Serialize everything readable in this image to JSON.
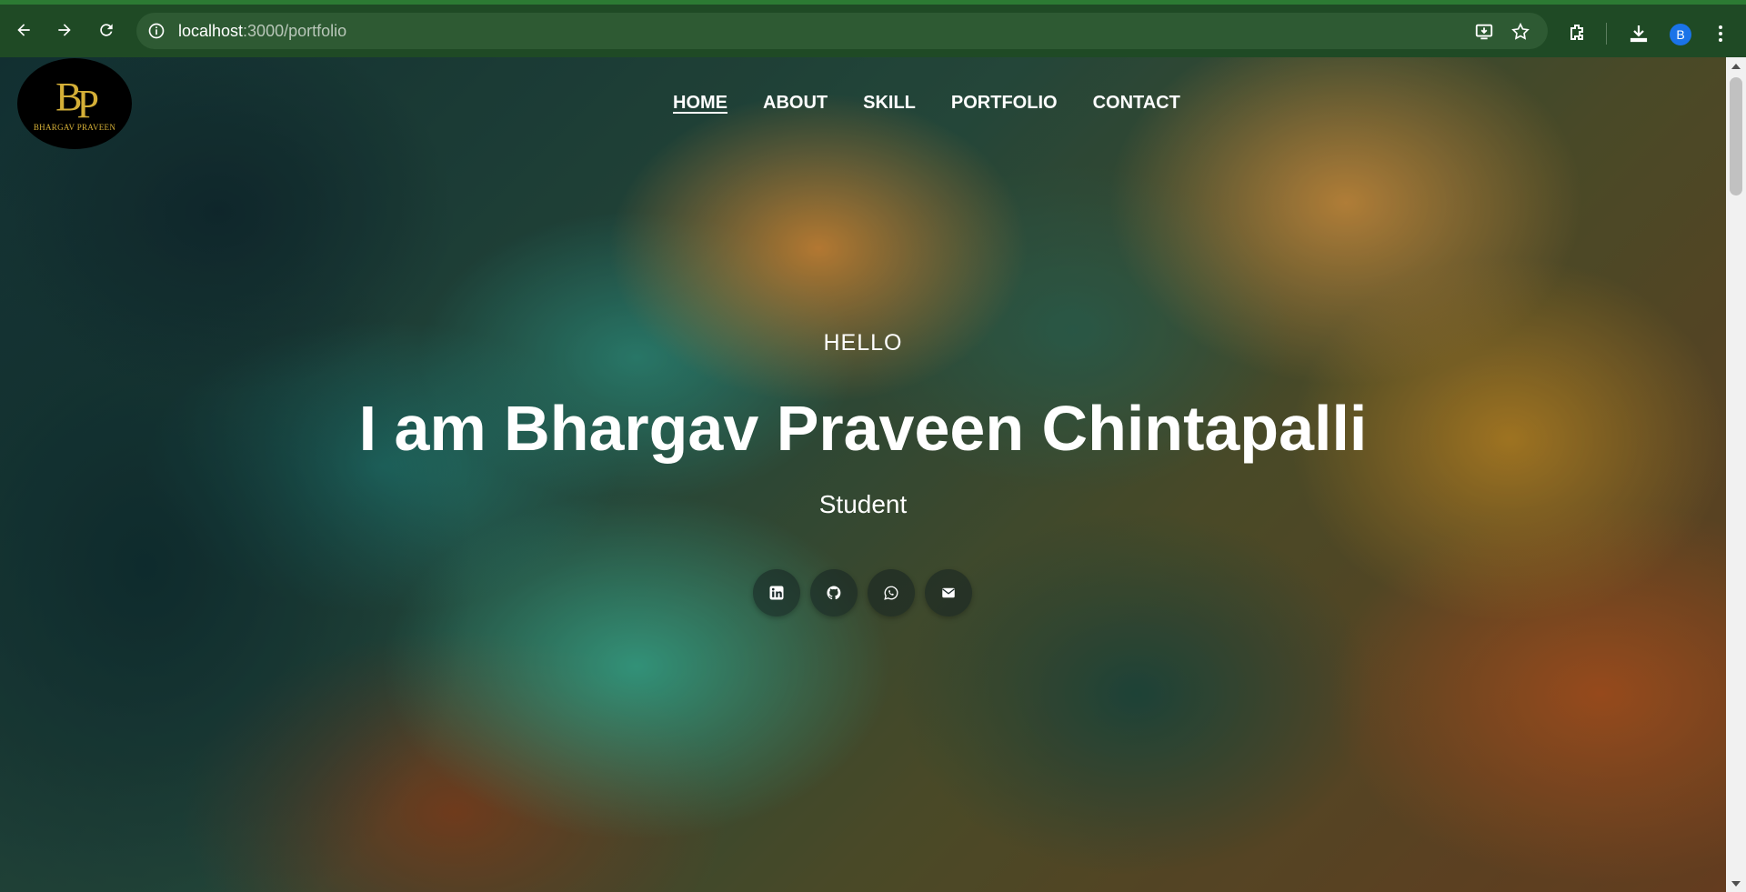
{
  "browser": {
    "url_host": "localhost",
    "url_path": ":3000/portfolio",
    "profile_initial": "B",
    "accent_color": "#1f4a25"
  },
  "site": {
    "logo": {
      "monogram_first": "B",
      "monogram_second": "P",
      "name": "Bhargav Praveen"
    },
    "nav": [
      {
        "label": "HOME",
        "active": true
      },
      {
        "label": "ABOUT",
        "active": false
      },
      {
        "label": "SKILL",
        "active": false
      },
      {
        "label": "PORTFOLIO",
        "active": false
      },
      {
        "label": "CONTACT",
        "active": false
      }
    ],
    "hero": {
      "greeting": "HELLO",
      "headline": "I am Bhargav Praveen Chintapalli",
      "role": "Student"
    },
    "socials": [
      {
        "icon": "linkedin-icon"
      },
      {
        "icon": "github-icon"
      },
      {
        "icon": "whatsapp-icon"
      },
      {
        "icon": "email-icon"
      }
    ]
  }
}
